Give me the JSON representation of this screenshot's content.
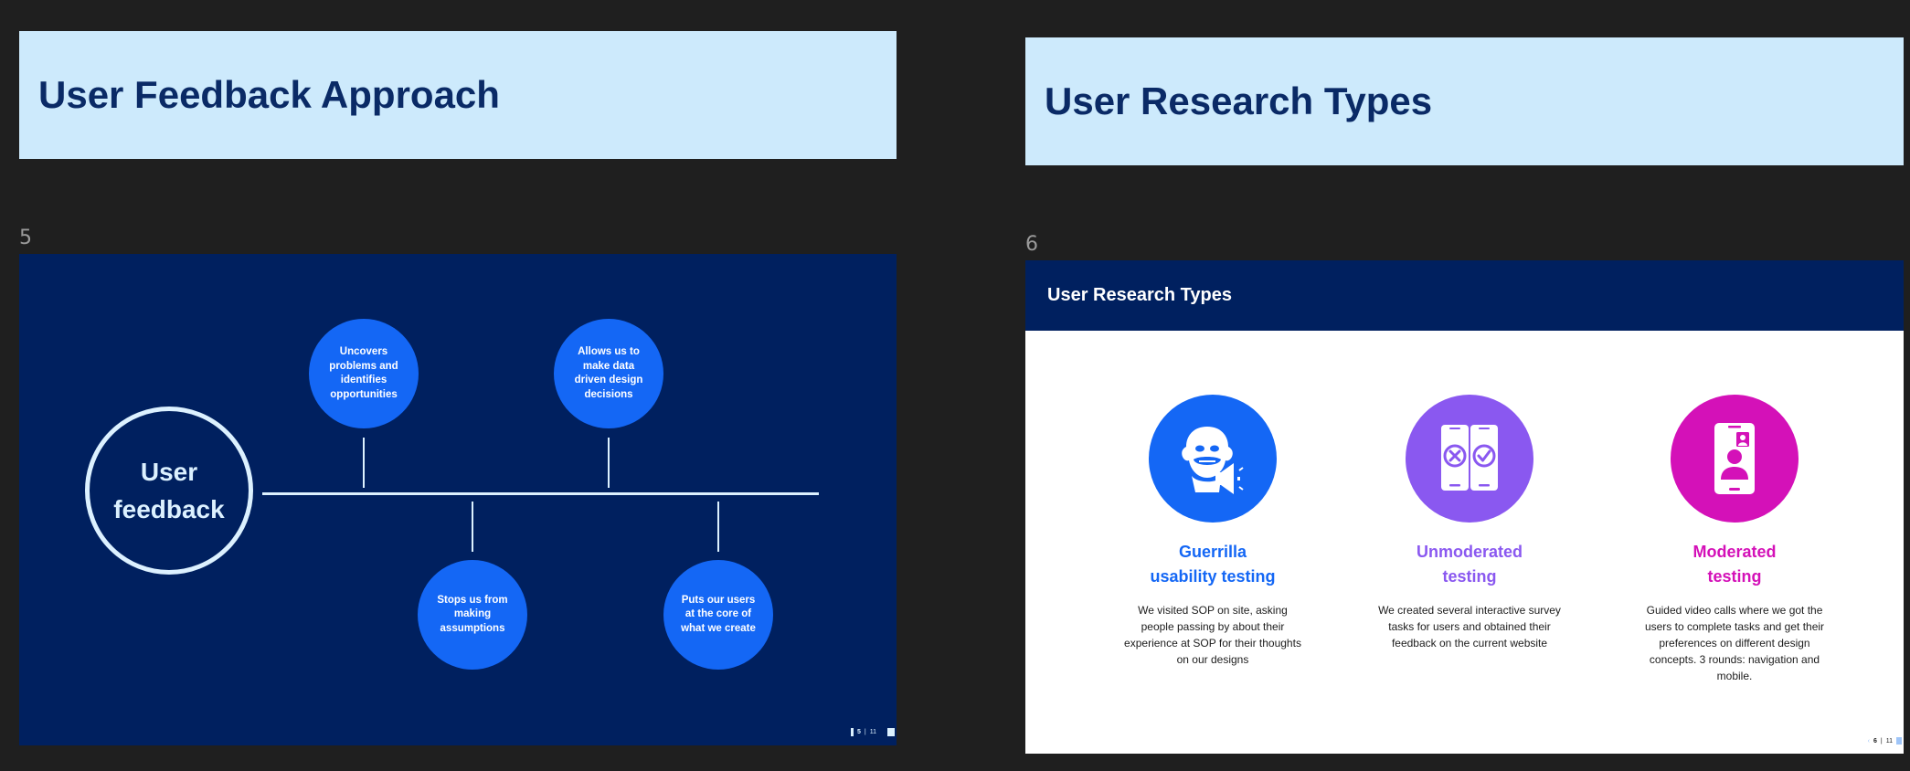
{
  "slides": [
    {
      "number": "5",
      "title": "User Feedback Approach",
      "hub": "User feedback",
      "points": [
        "Uncovers problems and identifies opportunities",
        "Allows us to make data driven design decisions",
        "Stops us from making assumptions",
        "Puts our users at the core of what we create"
      ],
      "pager": {
        "current": "5",
        "total": "11"
      }
    },
    {
      "number": "6",
      "title": "User Research Types",
      "header": "User Research Types",
      "types": [
        {
          "icon": "gorilla-megaphone-icon",
          "color": "#1467f5",
          "name_line1": "Guerrilla",
          "name_line2": "usability testing",
          "description": "We visited SOP on site, asking people passing by about their experience at SOP for their thoughts on our designs"
        },
        {
          "icon": "phones-check-cross-icon",
          "color": "#8a58f0",
          "name_line1": "Unmoderated",
          "name_line2": "testing",
          "description": "We created several interactive survey tasks for users and obtained their feedback on the current website"
        },
        {
          "icon": "video-call-phone-icon",
          "color": "#d411b8",
          "name_line1": "Moderated",
          "name_line2": "testing",
          "description": "Guided video calls where we got the users to complete tasks and get their preferences on different design concepts. 3 rounds: navigation and mobile."
        }
      ],
      "pager": {
        "current": "6",
        "total": "11"
      }
    }
  ]
}
